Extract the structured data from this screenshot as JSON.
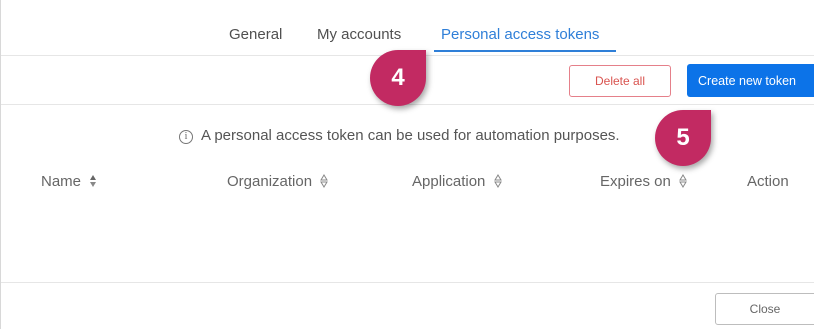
{
  "tabs": {
    "general": "General",
    "my_accounts": "My accounts",
    "personal_access_tokens": "Personal access tokens"
  },
  "toolbar": {
    "delete_all": "Delete all",
    "create_new_token": "Create new token"
  },
  "info": {
    "text": "A personal access token can be used for automation purposes."
  },
  "table": {
    "columns": [
      "Name",
      "Organization",
      "Application",
      "Expires on",
      "Action"
    ]
  },
  "footer": {
    "close": "Close"
  },
  "markers": [
    "4",
    "5"
  ],
  "colors": {
    "accent": "#2f7fd8",
    "primary_button": "#0c73e8",
    "danger": "#d9534f",
    "marker": "#c22a62"
  }
}
